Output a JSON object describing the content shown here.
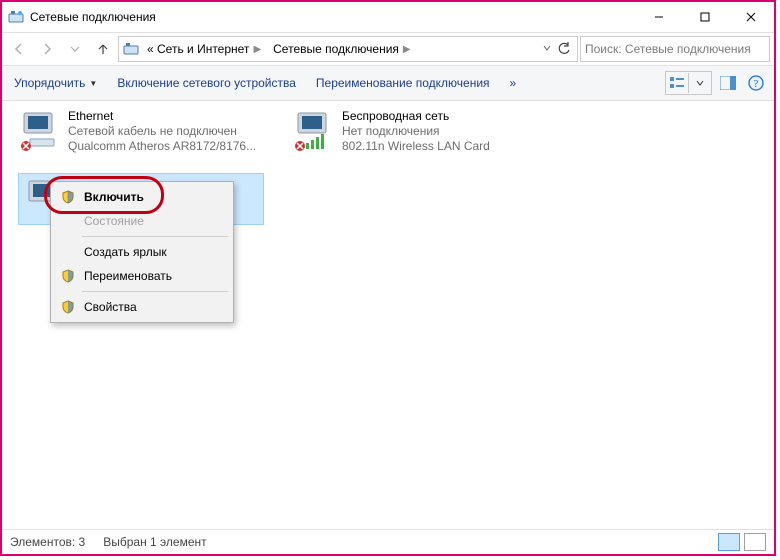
{
  "window": {
    "title": "Сетевые подключения"
  },
  "breadcrumb": {
    "seg1": "« Сеть и Интернет",
    "seg2": "Сетевые подключения"
  },
  "search": {
    "placeholder": "Поиск: Сетевые подключения"
  },
  "toolbar": {
    "organize": "Упорядочить",
    "enable_device": "Включение сетевого устройства",
    "rename_connection": "Переименование подключения",
    "more": "»"
  },
  "connections": {
    "ethernet": {
      "name": "Ethernet",
      "status": "Сетевой кабель не подключен",
      "device": "Qualcomm Atheros AR8172/8176..."
    },
    "wifi": {
      "name": "Беспроводная сеть",
      "status": "Нет подключения",
      "device": "802.11n Wireless LAN Card"
    }
  },
  "context_menu": {
    "enable": "Включить",
    "state": "Состояние",
    "create_shortcut": "Создать ярлык",
    "rename": "Переименовать",
    "properties": "Свойства"
  },
  "statusbar": {
    "count_label": "Элементов: 3",
    "selection_label": "Выбран 1 элемент"
  }
}
